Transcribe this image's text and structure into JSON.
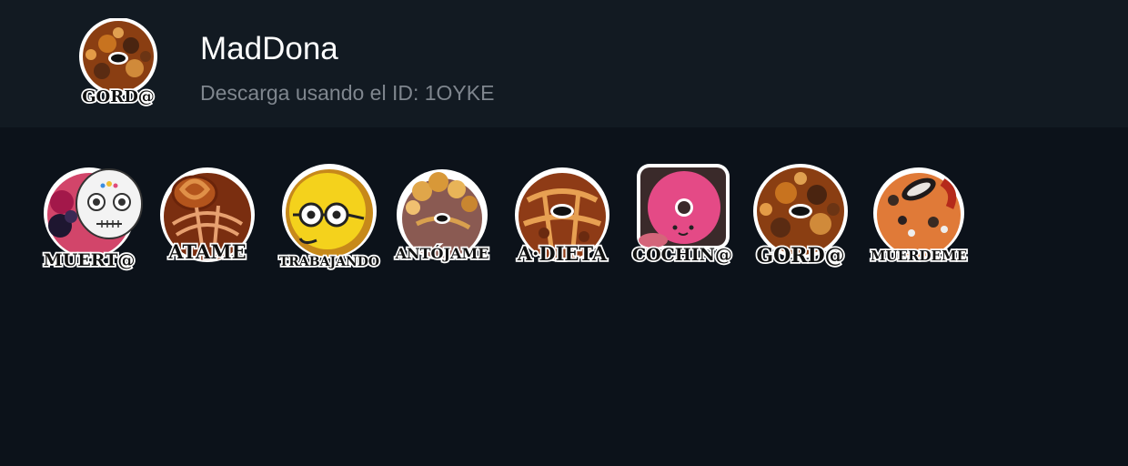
{
  "pack": {
    "title": "MadDona",
    "download_text": "Descarga usando el ID: 1OYKE",
    "thumbnail_caption": "GORD@"
  },
  "stickers": [
    {
      "caption": "MUERT@",
      "icon": "sugar-skull-donut"
    },
    {
      "caption": "ATAME",
      "icon": "pretzel-donut"
    },
    {
      "caption": "TRABAJANDO",
      "icon": "glasses-smiley-donut"
    },
    {
      "caption": "ANTÓJAME",
      "icon": "popcorn-donut"
    },
    {
      "caption": "A·DIETA",
      "icon": "caramel-donut"
    },
    {
      "caption": "COCHIN@",
      "icon": "pink-piggy-donut"
    },
    {
      "caption": "GORD@",
      "icon": "loaded-chocolate-donut"
    },
    {
      "caption": "MUERDEME",
      "icon": "cookie-bacon-donut"
    }
  ],
  "colors": {
    "header_bg": "#121a22",
    "page_bg": "#0c121a",
    "title": "#ffffff",
    "subtitle": "#7f868e"
  }
}
